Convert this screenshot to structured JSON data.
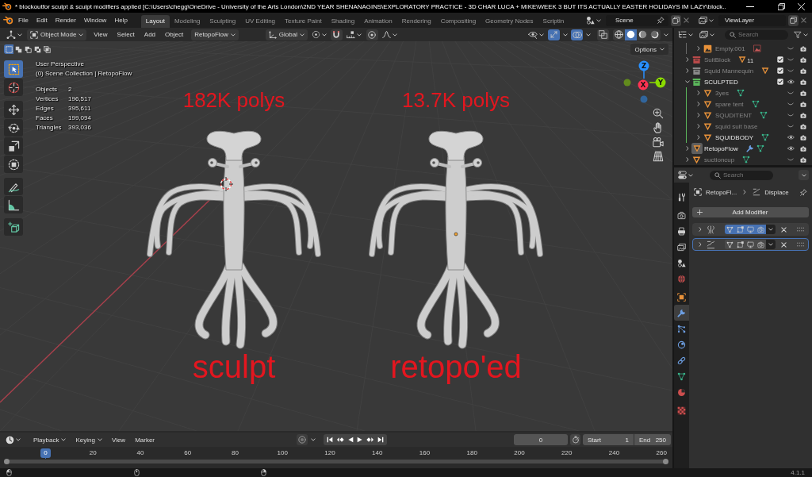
{
  "window": {
    "title": "* blockoutfor sculpt & sculpt modifiers applied [C:\\Users\\chegg\\OneDrive - University of the Arts London\\2ND YEAR SHENANAGINS\\EXPLORATORY PRACTICE - 3D CHAR LUCA + MIKE\\WEEK 3 BUT ITS ACTUALLY EASTER HOLIDAYS IM LAZY\\block.."
  },
  "menu": [
    "File",
    "Edit",
    "Render",
    "Window",
    "Help"
  ],
  "workspaces": [
    {
      "label": "Layout",
      "selected": true
    },
    {
      "label": "Modeling",
      "selected": false
    },
    {
      "label": "Sculpting",
      "selected": false
    },
    {
      "label": "UV Editing",
      "selected": false
    },
    {
      "label": "Texture Paint",
      "selected": false
    },
    {
      "label": "Shading",
      "selected": false
    },
    {
      "label": "Animation",
      "selected": false
    },
    {
      "label": "Rendering",
      "selected": false
    },
    {
      "label": "Compositing",
      "selected": false
    },
    {
      "label": "Geometry Nodes",
      "selected": false
    },
    {
      "label": "Scriptin",
      "selected": false
    }
  ],
  "scene": {
    "value": "Scene"
  },
  "view_layer": {
    "value": "ViewLayer"
  },
  "viewport_header": {
    "mode": "Object Mode",
    "menus": [
      "View",
      "Select",
      "Add",
      "Object"
    ],
    "addon_menu": "RetopoFlow",
    "orientation": "Global",
    "snap": false,
    "proportional": false,
    "gizmos": true,
    "overlays": true,
    "xray": false,
    "shading": [
      {
        "kind": "wireframe",
        "selected": false
      },
      {
        "kind": "solid",
        "selected": true
      },
      {
        "kind": "material",
        "selected": false
      },
      {
        "kind": "rendered",
        "selected": false
      }
    ]
  },
  "toolbar": {
    "select_modes": [
      {
        "kind": "set",
        "selected": true
      },
      {
        "kind": "extend",
        "selected": false
      },
      {
        "kind": "subtract",
        "selected": false
      },
      {
        "kind": "invert",
        "selected": false
      },
      {
        "kind": "intersect",
        "selected": false
      }
    ],
    "groups": [
      {
        "tools": [
          {
            "kind": "select_box",
            "selected": true
          },
          {
            "kind": "cursor",
            "selected": false
          }
        ]
      },
      {
        "tools": [
          {
            "kind": "move",
            "selected": false
          },
          {
            "kind": "rotate",
            "selected": false
          },
          {
            "kind": "scale",
            "selected": false
          },
          {
            "kind": "transform",
            "selected": false
          }
        ]
      },
      {
        "tools": [
          {
            "kind": "annotate",
            "selected": false
          },
          {
            "kind": "measure",
            "selected": false
          }
        ]
      },
      {
        "tools": [
          {
            "kind": "add_cube",
            "selected": false
          }
        ]
      }
    ]
  },
  "viewport_info": {
    "view": "User Perspective",
    "collection": "(0) Scene Collection | RetopoFlow",
    "stats": [
      {
        "label": "Objects",
        "value": "2"
      },
      {
        "label": "Vertices",
        "value": "196,517"
      },
      {
        "label": "Edges",
        "value": "395,611"
      },
      {
        "label": "Faces",
        "value": "199,094"
      },
      {
        "label": "Triangles",
        "value": "393,036"
      }
    ]
  },
  "options": "Options",
  "models": [
    {
      "note_above": "182K polys",
      "note_below": "sculpt"
    },
    {
      "note_above": "13.7K polys",
      "note_below": "retopo'ed"
    }
  ],
  "gizmo": {
    "axes": [
      {
        "label": "X",
        "color": "#ff3352"
      },
      {
        "label": "Y",
        "color": "#8bdc00"
      },
      {
        "label": "Z",
        "color": "#2890ff"
      }
    ]
  },
  "outliner": {
    "search": {
      "placeholder": "Search"
    },
    "items": [
      {
        "children": [
          {
            "kind": "image_empty",
            "name": "Empty.001",
            "visible": false,
            "selected": false,
            "expanded": false,
            "extras": [
              {
                "kind": "image"
              }
            ]
          }
        ]
      },
      {
        "kind": "collection",
        "name": "SuitBlock",
        "color": "#b94a4a",
        "checked": true,
        "visible": false,
        "selected": false,
        "expanded": false,
        "extras": [
          {
            "kind": "mesh_object",
            "count": "11"
          }
        ]
      },
      {
        "kind": "collection",
        "name": "Squid Mannequin",
        "color": "#8a8a8a",
        "checked": true,
        "visible": false,
        "selected": false,
        "expanded": false,
        "extras": [
          {
            "kind": "mesh_object"
          }
        ]
      },
      {
        "kind": "collection",
        "name": "SCULPTED",
        "color": "#5cb85c",
        "checked": true,
        "visible": true,
        "selected": false,
        "expanded": true,
        "children": [
          {
            "kind": "mesh_object",
            "name": "3yes",
            "visible": false,
            "selected": false,
            "expanded": false,
            "extras": [
              {
                "kind": "mesh_data"
              }
            ]
          },
          {
            "kind": "mesh_object",
            "name": "spare tent",
            "visible": false,
            "selected": false,
            "expanded": false,
            "extras": [
              {
                "kind": "mesh_data"
              }
            ]
          },
          {
            "kind": "mesh_object",
            "name": "SQUDITENT",
            "visible": false,
            "selected": false,
            "expanded": false,
            "extras": [
              {
                "kind": "mesh_data"
              }
            ]
          },
          {
            "kind": "mesh_object",
            "name": "squid suit base",
            "visible": false,
            "selected": false,
            "expanded": false
          },
          {
            "kind": "mesh_object",
            "name": "SQUIDBODY",
            "visible": true,
            "selected": false,
            "expanded": false,
            "extras": [
              {
                "kind": "mesh_data"
              }
            ]
          }
        ]
      },
      {
        "kind": "mesh_object",
        "name": "RetopoFlow",
        "visible": true,
        "selected": true,
        "expanded": false,
        "extras": [
          {
            "kind": "modifier"
          },
          {
            "kind": "mesh_data"
          }
        ]
      },
      {
        "kind": "mesh_object",
        "name": "suctioncup",
        "visible": false,
        "selected": false,
        "expanded": false,
        "extras": [
          {
            "kind": "mesh_data"
          }
        ]
      }
    ]
  },
  "properties": {
    "search": {
      "placeholder": "Search"
    },
    "tab_groups": [
      {
        "tabs": [
          {
            "kind": "tool",
            "selected": false
          }
        ]
      },
      {
        "tabs": [
          {
            "kind": "render",
            "selected": false
          },
          {
            "kind": "output",
            "selected": false
          },
          {
            "kind": "view_layer",
            "selected": false
          },
          {
            "kind": "scene",
            "selected": false
          },
          {
            "kind": "world",
            "selected": false
          }
        ]
      },
      {
        "tabs": [
          {
            "kind": "object",
            "selected": false
          },
          {
            "kind": "modifiers",
            "selected": true
          },
          {
            "kind": "particles",
            "selected": false
          },
          {
            "kind": "physics",
            "selected": false
          },
          {
            "kind": "constraints",
            "selected": false
          },
          {
            "kind": "data",
            "selected": false
          },
          {
            "kind": "material",
            "selected": false
          }
        ]
      },
      {
        "tabs": [
          {
            "kind": "texture",
            "selected": false
          }
        ]
      }
    ],
    "breadcrumb": [
      {
        "kind": "object",
        "label": "RetopoFl..."
      },
      {
        "kind": "displace",
        "label": "Displace"
      }
    ],
    "add_button": "Add Modifier",
    "modifiers": [
      {
        "kind": "multires",
        "expanded": false,
        "selected": false,
        "toggles": [
          {
            "kind": "edit_mode",
            "on": true
          },
          {
            "kind": "on_cage",
            "on": true
          },
          {
            "kind": "viewport",
            "on": true
          },
          {
            "kind": "render",
            "on": true
          }
        ]
      },
      {
        "kind": "displace",
        "expanded": false,
        "selected": true,
        "toggles": [
          {
            "kind": "edit_mode",
            "on": false
          },
          {
            "kind": "on_cage",
            "on": false
          },
          {
            "kind": "viewport",
            "on": false
          },
          {
            "kind": "render",
            "on": false
          }
        ]
      }
    ]
  },
  "timeline": {
    "menus": [
      {
        "label": "Playback",
        "kind": "dropdown"
      },
      {
        "label": "Keying",
        "kind": "dropdown"
      },
      {
        "label": "View",
        "kind": "menu"
      },
      {
        "label": "Marker",
        "kind": "menu"
      }
    ],
    "auto_key": false,
    "current_frame": "0",
    "start": {
      "label": "Start",
      "value": "1"
    },
    "end": {
      "label": "End",
      "value": "250"
    },
    "playhead": "0",
    "ticks": [
      "20",
      "40",
      "60",
      "80",
      "100",
      "120",
      "140",
      "160",
      "180",
      "200",
      "220",
      "240",
      "260"
    ]
  },
  "status_bar": {
    "version": "4.1.1"
  }
}
